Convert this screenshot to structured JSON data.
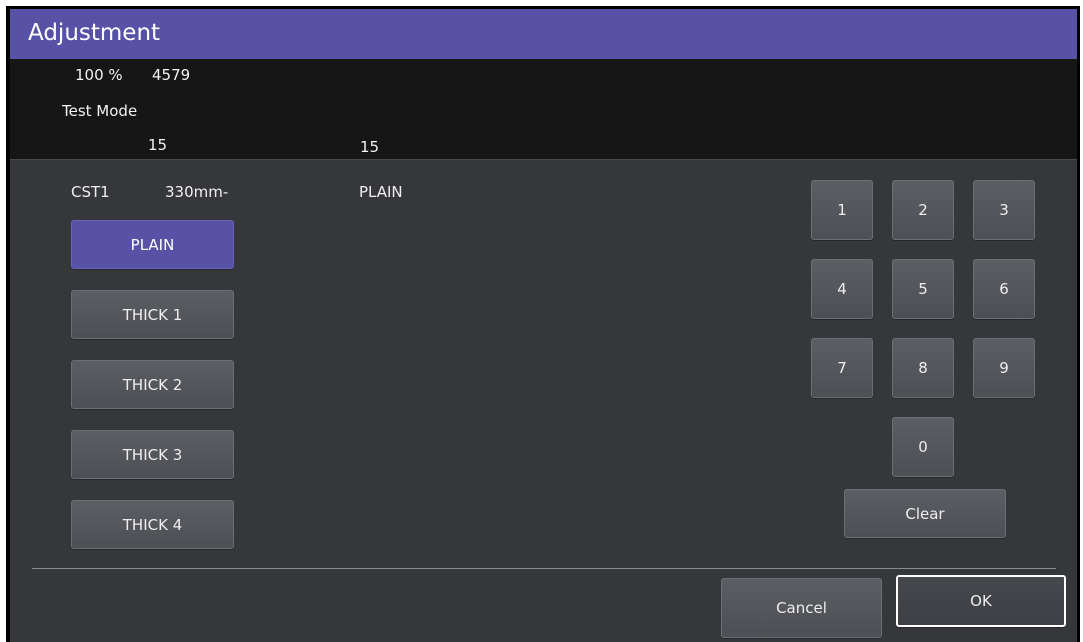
{
  "window": {
    "title": "Adjustment"
  },
  "status": {
    "zoom": "100 %",
    "count": "4579",
    "mode": "Test Mode",
    "value_left": "15",
    "value_right": "15"
  },
  "tray": {
    "cassette": "CST1",
    "size": "330mm-",
    "media": "PLAIN"
  },
  "paper_types": [
    {
      "label": "PLAIN",
      "selected": true
    },
    {
      "label": "THICK 1",
      "selected": false
    },
    {
      "label": "THICK 2",
      "selected": false
    },
    {
      "label": "THICK 3",
      "selected": false
    },
    {
      "label": "THICK 4",
      "selected": false
    }
  ],
  "keypad": {
    "keys": [
      "1",
      "2",
      "3",
      "4",
      "5",
      "6",
      "7",
      "8",
      "9",
      "0"
    ],
    "clear": "Clear"
  },
  "footer": {
    "cancel": "Cancel",
    "ok": "OK"
  },
  "colors": {
    "accent": "#5852a7",
    "panel": "#36373b",
    "status_bg": "#161616"
  }
}
